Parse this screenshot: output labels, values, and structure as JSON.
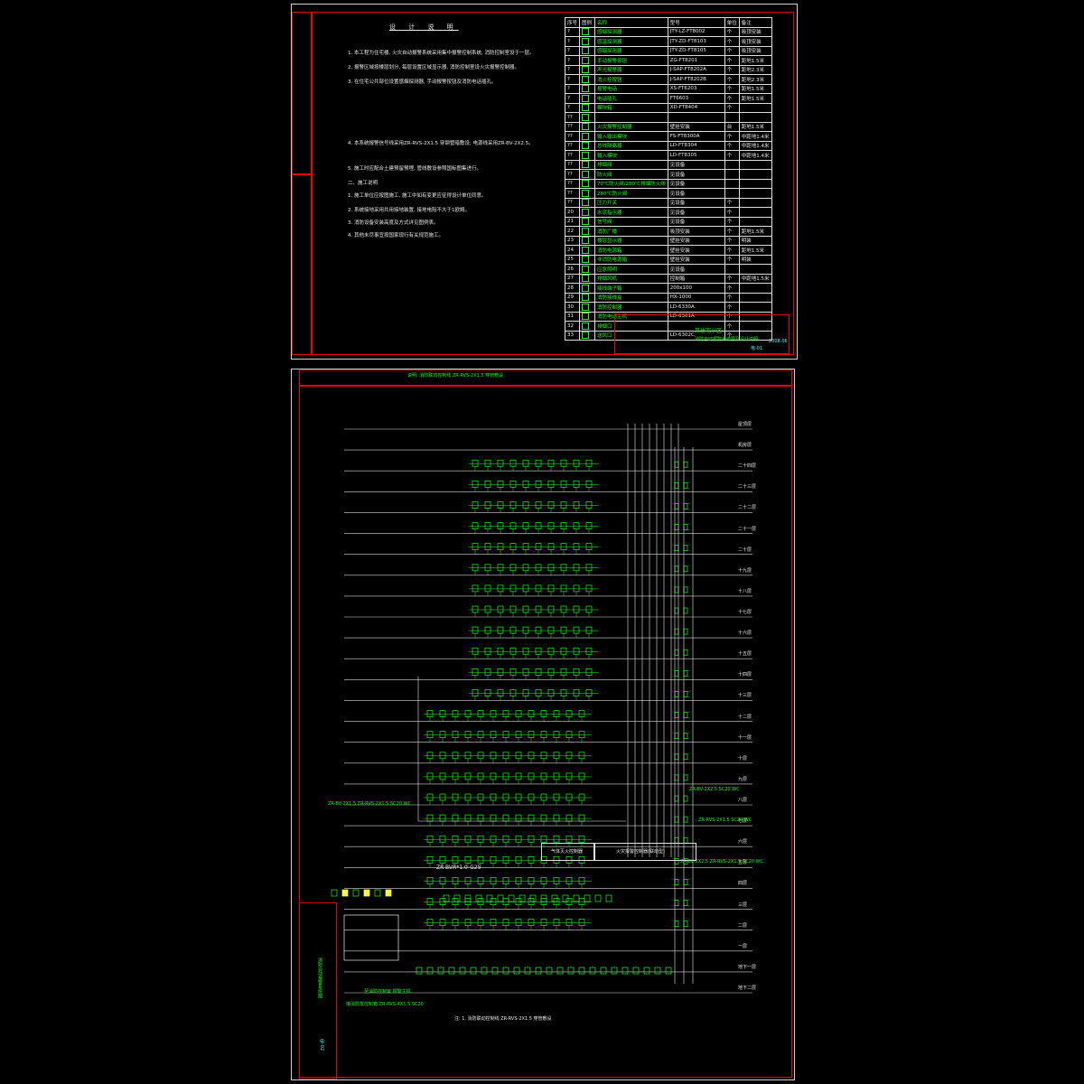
{
  "top_sheet": {
    "title": "设 计 说 明",
    "notes": [
      "1. 本工程为住宅楼, 火灾自动报警系统采用集中报警控制系统, 消防控制室设于一层。",
      "2. 报警区域按楼层划分, 每层设置区域显示器, 消防控制室设火灾报警控制器。",
      "3. 在住宅公共部位设置感烟探测器, 手动报警按钮及消防电话插孔。",
      "4. 本系统报警信号线采用ZR-RVS-2X1.5 穿钢管暗敷设; 电源线采用ZR-BV-2X2.5。",
      "5. 施工时应配合土建预留预埋, 管线敷设参照国标图集进行。",
      "二、施工说明",
      "1. 施工单位应按图施工, 施工中如有变更应征得设计单位同意。",
      "2. 系统接地采用共用接地装置, 接地电阻不大于1欧姆。",
      "3. 消防设备安装高度及方式详见图例表。",
      "4. 其他未尽事宜按国家现行有关规范施工。"
    ],
    "legend_header": [
      "序号",
      "图例",
      "名称",
      "型号",
      "单位",
      "备注"
    ],
    "legend_rows": [
      [
        "?",
        "",
        "感烟探测器",
        "JTY-LZ-FT8002",
        "个",
        "吸顶安装"
      ],
      [
        "?",
        "",
        "感温探测器",
        "JTY-ZD-FT8103",
        "个",
        "吸顶安装"
      ],
      [
        "?",
        "",
        "感烟探测器",
        "JTY-ZD-FT8105",
        "个",
        "吸顶安装"
      ],
      [
        "?",
        "",
        "手动报警按钮",
        "ZG-FT8201",
        "个",
        "距地1.5米"
      ],
      [
        "?",
        "",
        "声光报警器",
        "J-SAP-FT8202A",
        "个",
        "距地2.3米"
      ],
      [
        "?",
        "",
        "消火栓按钮",
        "J-SAP-FT8202B",
        "个",
        "距地2.3米"
      ],
      [
        "?",
        "",
        "报警电话",
        "XS-FT6203",
        "个",
        "距地1.5米"
      ],
      [
        "?",
        "",
        "电话插孔",
        "FT6603",
        "个",
        "距地1.5米"
      ],
      [
        "?",
        "",
        "模块箱",
        "XD-FT8404",
        "个",
        ""
      ],
      [
        "??",
        "",
        "",
        "",
        "",
        ""
      ],
      [
        "??",
        "",
        "火灾报警控制器",
        "壁挂安装",
        "台",
        "距地1.5米"
      ],
      [
        "??",
        "",
        "输入输出模块",
        "FS-FT8300A",
        "个",
        "中距地1.4米"
      ],
      [
        "??",
        "",
        "总线隔离器",
        "LD-FT8304",
        "个",
        "中距地1.4米"
      ],
      [
        "??",
        "",
        "输入模块",
        "LD-FT8305",
        "个",
        "中距地1.4米"
      ],
      [
        "??",
        "",
        "排烟阀",
        "见设备",
        "",
        ""
      ],
      [
        "??",
        "",
        "防火阀",
        "见设备",
        "",
        ""
      ],
      [
        "??",
        "",
        "70℃防火阀/280℃排烟防火阀",
        "见设备",
        "",
        ""
      ],
      [
        "??",
        "",
        "280℃防火阀",
        "见设备",
        "",
        ""
      ],
      [
        "??",
        "",
        "压力开关",
        "见设备",
        "个",
        ""
      ],
      [
        "20",
        "",
        "水流指示器",
        "见设备",
        "个",
        ""
      ],
      [
        "21",
        "",
        "信号阀",
        "见设备",
        "个",
        ""
      ],
      [
        "22",
        "",
        "消防广播",
        "吸顶安装",
        "个",
        "距地1.5米"
      ],
      [
        "23",
        "",
        "楼层显示器",
        "壁挂安装",
        "个",
        "明装"
      ],
      [
        "24",
        "",
        "消防电源箱",
        "壁挂安装",
        "个",
        "距地1.5米"
      ],
      [
        "25",
        "",
        "非消防电源箱",
        "壁挂安装",
        "个",
        "明装"
      ],
      [
        "26",
        "",
        "应急照明",
        "见设备",
        "",
        ""
      ],
      [
        "27",
        "",
        "排烟风机",
        "控制箱",
        "个",
        "中距地1.5米"
      ],
      [
        "28",
        "",
        "接线端子箱",
        "200x100",
        "个",
        ""
      ],
      [
        "29",
        "",
        "消防接线盒",
        "HX-1000",
        "个",
        ""
      ],
      [
        "30",
        "",
        "消防控制器",
        "LD-6330A",
        "个",
        ""
      ],
      [
        "31",
        "",
        "消防电话主机",
        "LD-6301A",
        "个",
        ""
      ],
      [
        "32",
        "",
        "排烟口",
        "",
        "个",
        ""
      ],
      [
        "33",
        "",
        "送风口",
        "LD-6302C",
        "个",
        ""
      ]
    ],
    "title_block": {
      "project": "某住宅小区",
      "drawing": "消防自动报警系统图及设计说明",
      "date": "2008.06",
      "sheet": "电-01"
    }
  },
  "bottom_sheet": {
    "header_note": "说明: 消防联动控制线 ZR-RVS-2X1.5 穿管敷设",
    "floor_labels": [
      "屋顶层",
      "机房层",
      "二十四层",
      "二十三层",
      "二十二层",
      "二十一层",
      "二十层",
      "十九层",
      "十八层",
      "十七层",
      "十六层",
      "十五层",
      "十四层",
      "十三层",
      "十二层",
      "十一层",
      "十层",
      "九层",
      "八层",
      "七层",
      "六层",
      "五层",
      "四层",
      "三层",
      "二层",
      "一层",
      "地下一层",
      "地下二层"
    ],
    "cable_labels": [
      "ZR-BV-2X1.5 ZR-RVS-2X1.5 SC20 WC",
      "ZR-BV-2X2.5 SC20 WC",
      "ZR-RVS-2X1.5 SC20 WC",
      "ZR-BVR*1.0-G25",
      "ZR-BV-2X2.5 ZR-RVS-2X1.5 SC20 WC"
    ],
    "control_boxes": [
      "气体灭火控制器",
      "火灾报警控制器(联动型)"
    ],
    "bottom_note": "注: 1. 消防联动控制线 ZR-RVS-2X1.5 穿管敷设",
    "left_note": "至消防控制室 报警主机",
    "left_note2": "接消防泵控制箱 ZR-RVS-4X1.5 SC20",
    "title_block": {
      "drawing": "消防自动报警系统图",
      "sheet": "电-02"
    }
  }
}
